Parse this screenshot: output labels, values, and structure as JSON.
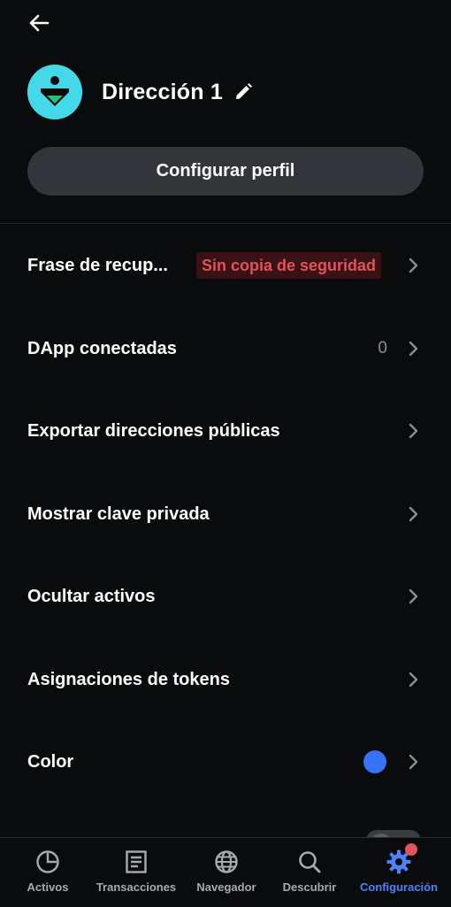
{
  "header": {
    "back_icon": "arrow-left-icon"
  },
  "profile": {
    "wallet_name": "Dirección 1",
    "avatar_icon": "wallet-avatar-icon",
    "edit_icon": "pencil-icon",
    "configure_label": "Configurar perfil"
  },
  "menu": {
    "items": [
      {
        "label": "Frase de recup...",
        "badge": "Sin copia de seguridad"
      },
      {
        "label": "DApp conectadas",
        "count": "0"
      },
      {
        "label": "Exportar direcciones públicas"
      },
      {
        "label": "Mostrar clave privada"
      },
      {
        "label": "Ocultar activos"
      },
      {
        "label": "Asignaciones de tokens"
      },
      {
        "label": "Color",
        "color_value": "#3773f5"
      }
    ]
  },
  "bottom_nav": {
    "items": [
      {
        "label": "Activos",
        "icon": "pie-chart-icon",
        "active": false
      },
      {
        "label": "Transacciones",
        "icon": "receipt-icon",
        "active": false
      },
      {
        "label": "Navegador",
        "icon": "globe-icon",
        "active": false
      },
      {
        "label": "Descubrir",
        "icon": "search-icon",
        "active": false
      },
      {
        "label": "Configuración",
        "icon": "gear-icon",
        "active": true,
        "notification": true
      }
    ]
  },
  "colors": {
    "background": "#0a0b0d",
    "accent": "#4b83f7",
    "warning": "#e0545b",
    "avatar": "#44d9e9"
  }
}
